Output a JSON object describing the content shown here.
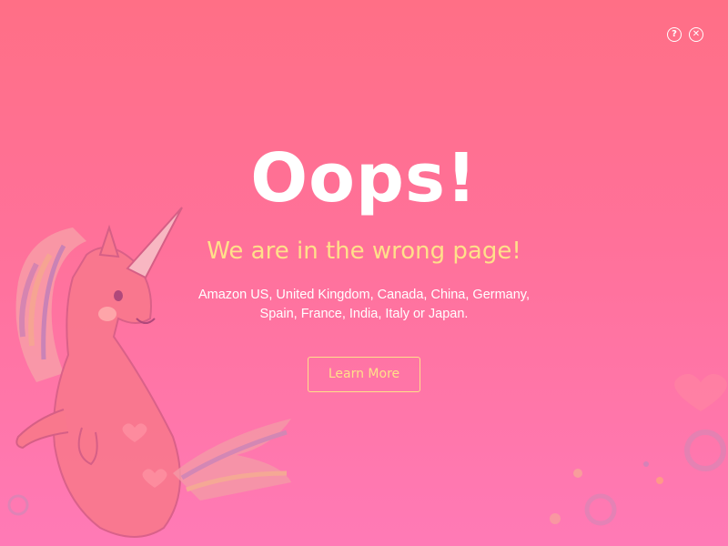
{
  "header": {
    "help_icon": "help-icon",
    "close_icon": "close-icon",
    "help_glyph": "?",
    "close_glyph": "✕"
  },
  "main": {
    "title": "Oops!",
    "subtitle": "We are in the wrong page!",
    "description_line1": "Amazon US, United Kingdom, Canada, China, Germany,",
    "description_line2": "Spain, France, India, Italy or Japan.",
    "button_label": "Learn More"
  },
  "colors": {
    "background_top": "#ff6f86",
    "background_bottom": "#ff7ab6",
    "title": "#ffffff",
    "accent": "#ffe08a"
  }
}
